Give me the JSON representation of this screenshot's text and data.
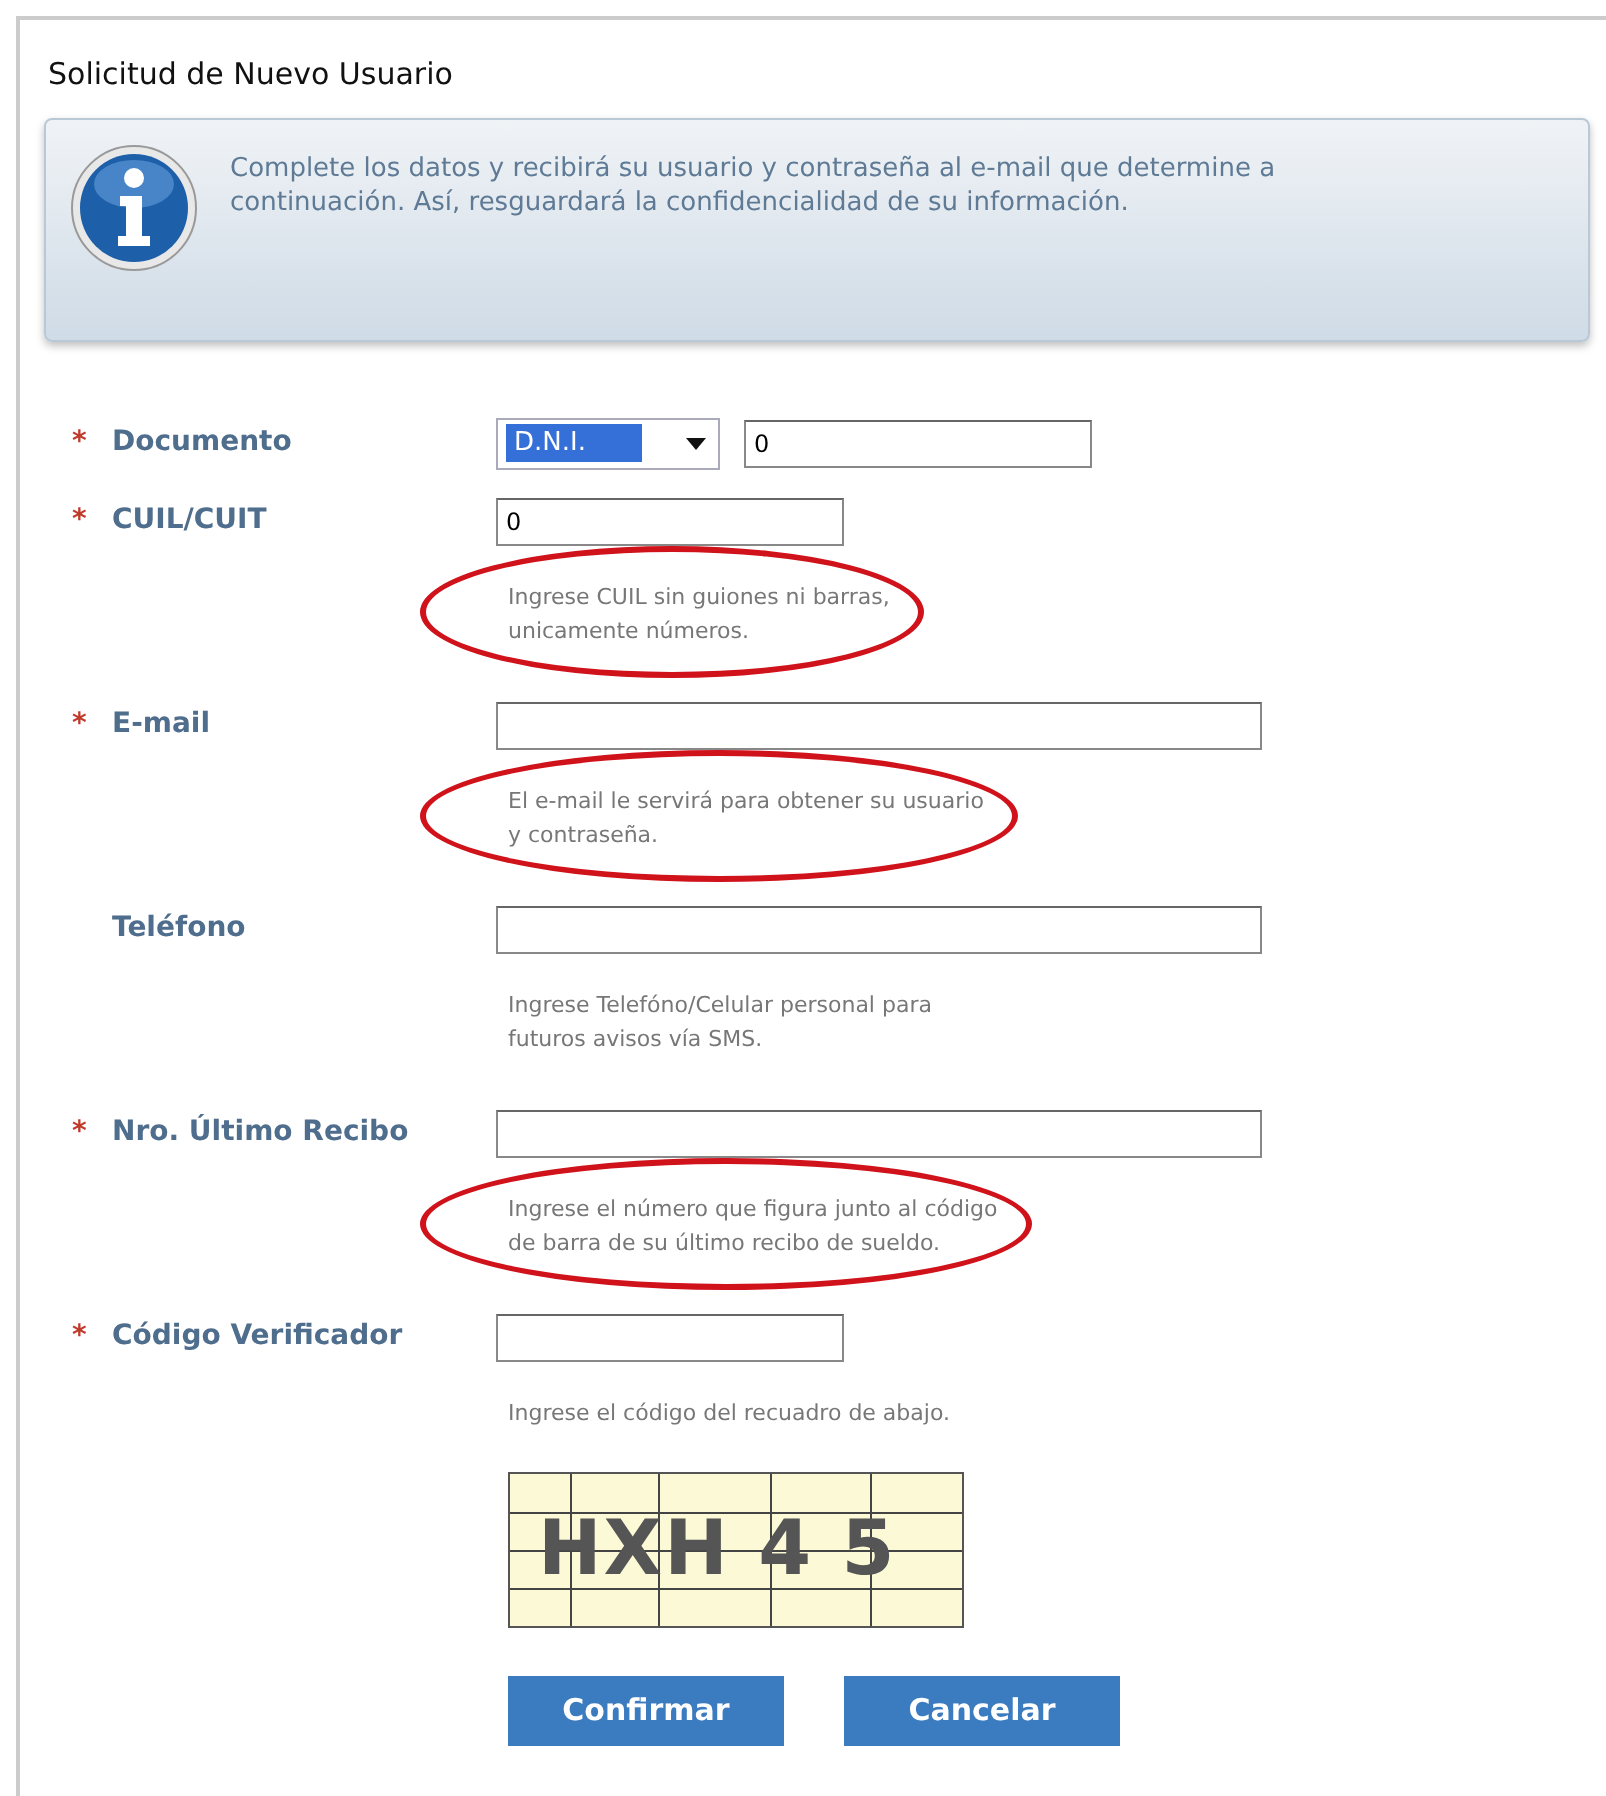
{
  "panel": {
    "title": "Solicitud de Nuevo Usuario"
  },
  "info": {
    "text": "Complete los datos y recibirá su usuario y contraseña al e-mail que determine a continuación. Así, resguardará la confidencialidad de su información."
  },
  "fields": [
    {
      "label": "Documento",
      "mark": "*",
      "inputs": [
        {
          "kind": "select",
          "value": "D.N.I.",
          "selected": true
        },
        {
          "kind": "text",
          "value": "0"
        }
      ]
    },
    {
      "label": "CUIL/CUIT",
      "mark": "*",
      "inputs": [
        {
          "kind": "text",
          "value": "0"
        }
      ],
      "hint": "Ingrese CUIL sin guiones ni barras,\nunicamente números.",
      "hint_highlighted": true
    },
    {
      "label": "E-mail",
      "mark": "*",
      "inputs": [
        {
          "kind": "text"
        }
      ],
      "hint": "El e-mail le servirá para obtener su usuario\ny contraseña.",
      "hint_highlighted": true
    },
    {
      "label": "Teléfono",
      "inputs": [
        {
          "kind": "text"
        }
      ],
      "hint": "Ingrese Telefóno/Celular personal para\nfuturos avisos vía SMS.",
      "hint_highlighted": false
    },
    {
      "label": "Nro. Último Recibo",
      "mark": "*",
      "inputs": [
        {
          "kind": "text"
        }
      ],
      "hint": "Ingrese el número que figura junto al código\nde barra de su último recibo de sueldo.",
      "hint_highlighted": true
    },
    {
      "label": "Código Verificador",
      "mark": "*",
      "inputs": [
        {
          "kind": "text"
        }
      ],
      "hint": "Ingrese el código del recuadro de abajo.",
      "hint_highlighted": false
    }
  ],
  "captcha": {
    "text": "HXH 4 5"
  },
  "buttons": [
    "Confirmar",
    "Cancelar"
  ]
}
